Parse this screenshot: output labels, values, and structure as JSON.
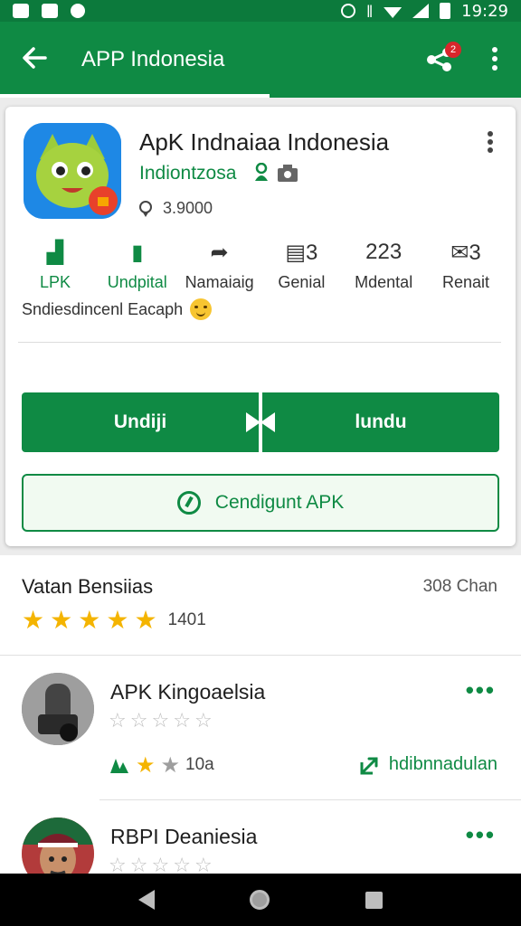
{
  "status_bar": {
    "time": "19:29"
  },
  "app_bar": {
    "title": "APP Indonesia",
    "notification_count": "2"
  },
  "app": {
    "name": "ApK Indnaiaa Indonesia",
    "developer": "Indiontzosa",
    "size": "3.9000"
  },
  "stats": [
    {
      "icon": "chart-icon",
      "glyph": "▟",
      "label": "LPK",
      "green": true
    },
    {
      "icon": "bookmark-icon",
      "glyph": "▮",
      "label": "Undpital",
      "green": true
    },
    {
      "icon": "share-arrow-icon",
      "glyph": "➦",
      "label": "Namaiaig",
      "green": false
    },
    {
      "icon": "calendar-icon",
      "glyph": "▤3",
      "label": "Genial",
      "green": false
    },
    {
      "icon": "counter-icon",
      "glyph": "223",
      "label": "Mdental",
      "green": false
    },
    {
      "icon": "mail-icon",
      "glyph": "✉3",
      "label": "Renait",
      "green": false
    }
  ],
  "tagline": "Sndiesdincenl Eacaph",
  "buttons": {
    "left_label": "Undiji",
    "right_label": "lundu",
    "outline_label": "Cendigunt APK"
  },
  "reviews": {
    "title": "Vatan Bensiias",
    "count": "308 Chan",
    "rating_text": "1401",
    "rating_stars": 5,
    "items": [
      {
        "name": "APK Kingoaelsia",
        "stars": 0,
        "meta_text": "10a",
        "helpful_label": "hdibnnadulan"
      },
      {
        "name": "RBPI Deaniesia",
        "stars": 0
      }
    ]
  },
  "colors": {
    "primary": "#0f8a44",
    "star": "#f4b400",
    "badge": "#d8262b"
  }
}
